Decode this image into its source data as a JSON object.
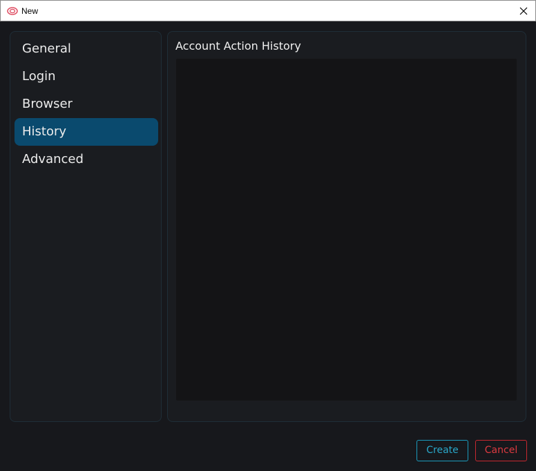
{
  "window": {
    "title": "New",
    "app_icon": "pink-infinity-logo-icon",
    "close_icon": "close-icon"
  },
  "nav": {
    "items": [
      {
        "label": "General",
        "active": false
      },
      {
        "label": "Login",
        "active": false
      },
      {
        "label": "Browser",
        "active": false
      },
      {
        "label": "History",
        "active": true
      },
      {
        "label": "Advanced",
        "active": false
      }
    ]
  },
  "main": {
    "section_title": "Account Action History",
    "history_entries": []
  },
  "footer": {
    "create_label": "Create",
    "cancel_label": "Cancel"
  },
  "colors": {
    "background": "#17181c",
    "active_item": "#0a4a6e",
    "create_accent": "#2aa7c9",
    "cancel_accent": "#de3a40"
  }
}
